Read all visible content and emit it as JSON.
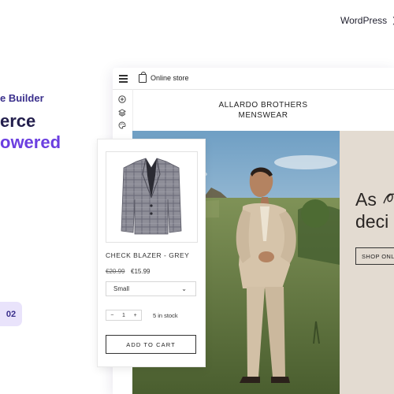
{
  "nav": {
    "platform_label": "WordPress"
  },
  "hero": {
    "kicker": "e Builder",
    "line1": "erce",
    "line2": "owered",
    "badge": "02"
  },
  "builder": {
    "topbar": {
      "store_label": "Online store"
    },
    "store": {
      "name_line1": "ALLARDO BROTHERS",
      "name_line2": "MENSWEAR"
    },
    "promo": {
      "line1": "As",
      "line2": "deci",
      "button_label": "SHOP ONL"
    }
  },
  "product": {
    "name": "CHECK BLAZER - GREY",
    "price_old": "€20.99",
    "price_new": "€15.99",
    "size": "Small",
    "quantity": "1",
    "qty_minus": "−",
    "qty_plus": "+",
    "stock": "5 in stock",
    "add_to_cart": "ADD TO CART"
  },
  "icons": {
    "nav_chevron": "chevron-down-icon",
    "menu": "hamburger-menu-icon",
    "store": "shopping-bag-icon",
    "sidebar": [
      "add-circle-icon",
      "layers-icon",
      "palette-icon"
    ]
  },
  "colors": {
    "accent_dark": "#231f4d",
    "accent_purple": "#6b3fe0",
    "badge_bg": "#e9e3fb",
    "promo_bg": "#e3dbd1"
  }
}
